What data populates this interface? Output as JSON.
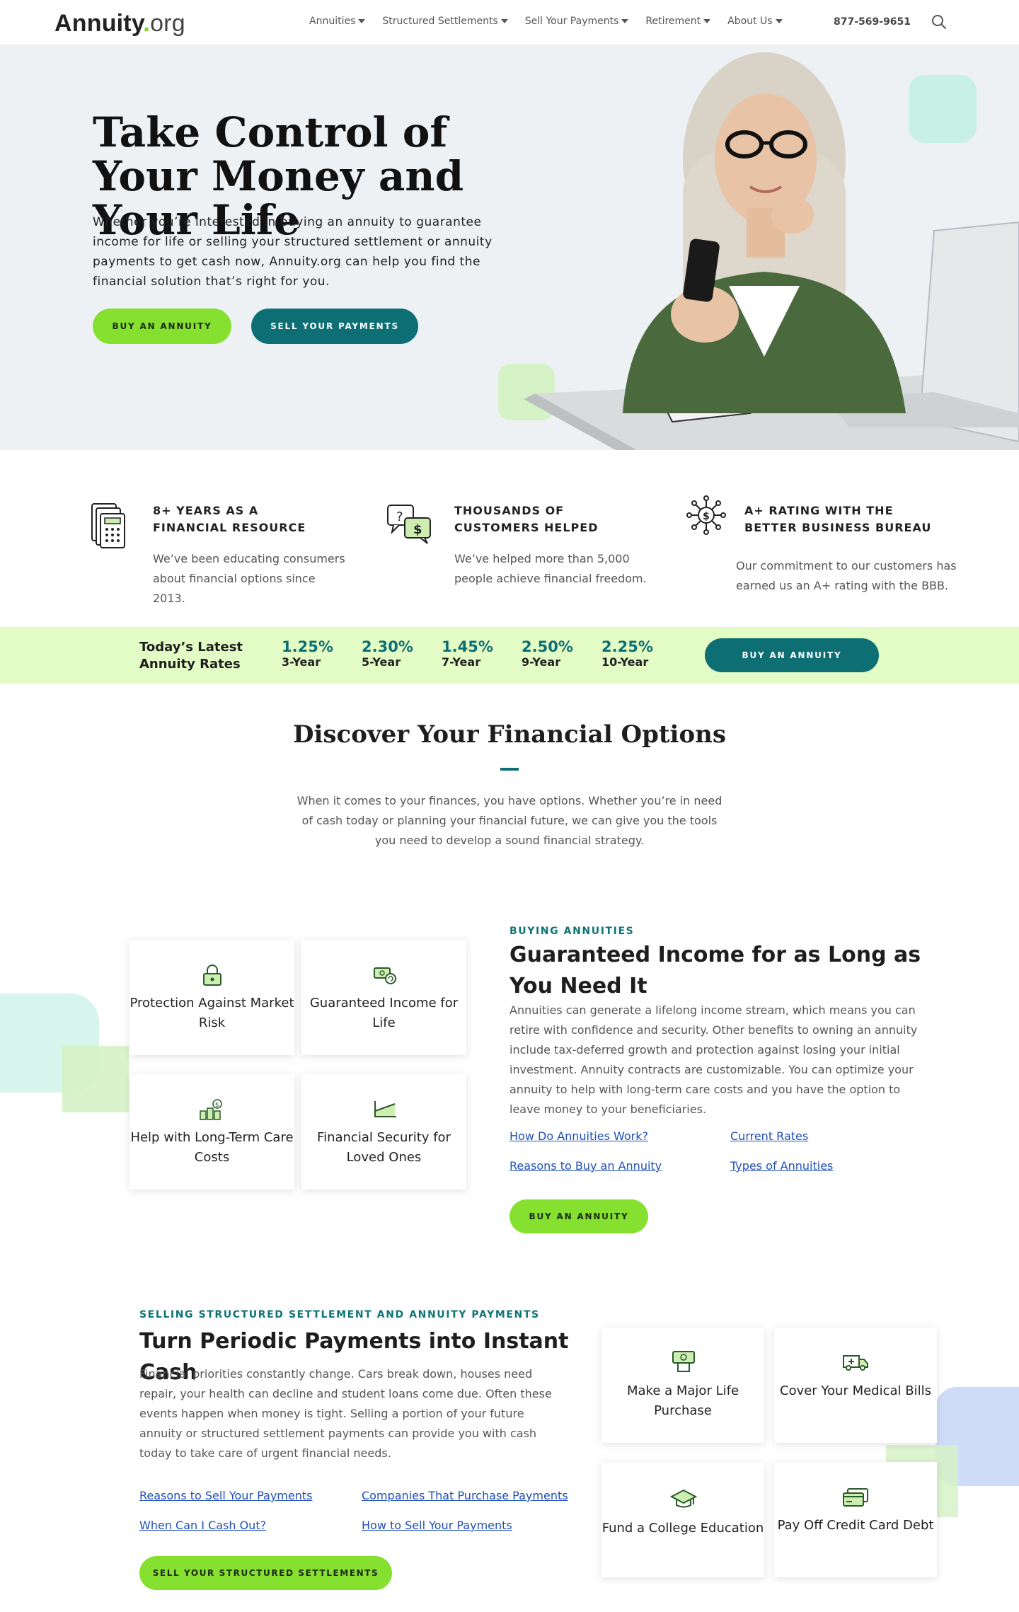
{
  "header": {
    "logo_main": "Annuity",
    "logo_dot": ".",
    "logo_tld": "org",
    "nav": [
      "Annuities",
      "Structured Settlements",
      "Sell Your Payments",
      "Retirement",
      "About Us"
    ],
    "phone": "877-569-9651"
  },
  "hero": {
    "title": "Take Control of Your Money and Your Life",
    "text": "Whether you’re interested in buying an annuity to guarantee income for life or selling your structured settlement or annuity payments to get cash now, Annuity.org can help you find the financial solution that’s right for you.",
    "btn_buy": "BUY AN ANNUITY",
    "btn_sell": "SELL YOUR PAYMENTS"
  },
  "features": [
    {
      "title": "8+ YEARS AS A FINANCIAL RESOURCE",
      "text": "We’ve been educating consumers about financial options since 2013."
    },
    {
      "title": "THOUSANDS OF CUSTOMERS HELPED",
      "text": "We’ve helped more than 5,000 people achieve financial freedom."
    },
    {
      "title": "A+ RATING WITH THE BETTER BUSINESS BUREAU",
      "text": "Our commitment to our customers has earned us an A+ rating with the BBB."
    }
  ],
  "rates": {
    "title": "Today’s Latest Annuity Rates",
    "items": [
      {
        "pct": "1.25%",
        "term": "3-Year"
      },
      {
        "pct": "2.30%",
        "term": "5-Year"
      },
      {
        "pct": "1.45%",
        "term": "7-Year"
      },
      {
        "pct": "2.50%",
        "term": "9-Year"
      },
      {
        "pct": "2.25%",
        "term": "10-Year"
      }
    ],
    "btn": "BUY AN ANNUITY"
  },
  "discover": {
    "title": "Discover Your Financial Options",
    "text": "When it comes to your finances, you have options. Whether you’re in need of cash today or planning your financial future, we can give you the tools you need to develop a sound financial strategy."
  },
  "buying": {
    "cards": [
      "Protection Against Market Risk",
      "Guaranteed Income for Life",
      "Help with Long-Term Care Costs",
      "Financial Security for Loved Ones"
    ],
    "eyebrow": "BUYING ANNUITIES",
    "title": "Guaranteed Income for as Long as You Need It",
    "text": "Annuities can generate a lifelong income stream, which means you can retire with confidence and security. Other benefits to owning an annuity include tax-deferred growth and protection against losing your initial investment. Annuity contracts are customizable. You can optimize your annuity to help with long-term care costs and you have the option to leave money to your beneficiaries.",
    "links": [
      "How Do Annuities Work?",
      "Current Rates",
      "Reasons to Buy an Annuity",
      "Types of Annuities"
    ],
    "btn": "BUY AN ANNUITY"
  },
  "selling": {
    "eyebrow": "SELLING STRUCTURED SETTLEMENT AND ANNUITY PAYMENTS",
    "title": "Turn Periodic Payments into Instant Cash",
    "text": "Financial priorities constantly change. Cars break down, houses need repair, your health can decline and student loans come due. Often these events happen when money is tight. Selling a portion of your future annuity or structured settlement payments can provide you with cash today to take care of urgent financial needs.",
    "links": [
      "Reasons to Sell Your Payments",
      "Companies That Purchase Payments",
      "When Can I Cash Out?",
      "How to Sell Your Payments"
    ],
    "btn": "SELL YOUR STRUCTURED SETTLEMENTS",
    "cards": [
      "Make a Major Life Purchase",
      "Cover Your Medical Bills",
      "Fund a College Education",
      "Pay Off Credit Card Debt"
    ]
  },
  "colors": {
    "accent_green": "#86e030",
    "accent_teal": "#0d6e74",
    "rates_bg": "#e3fbc4",
    "hero_bg": "#edf1f4"
  }
}
